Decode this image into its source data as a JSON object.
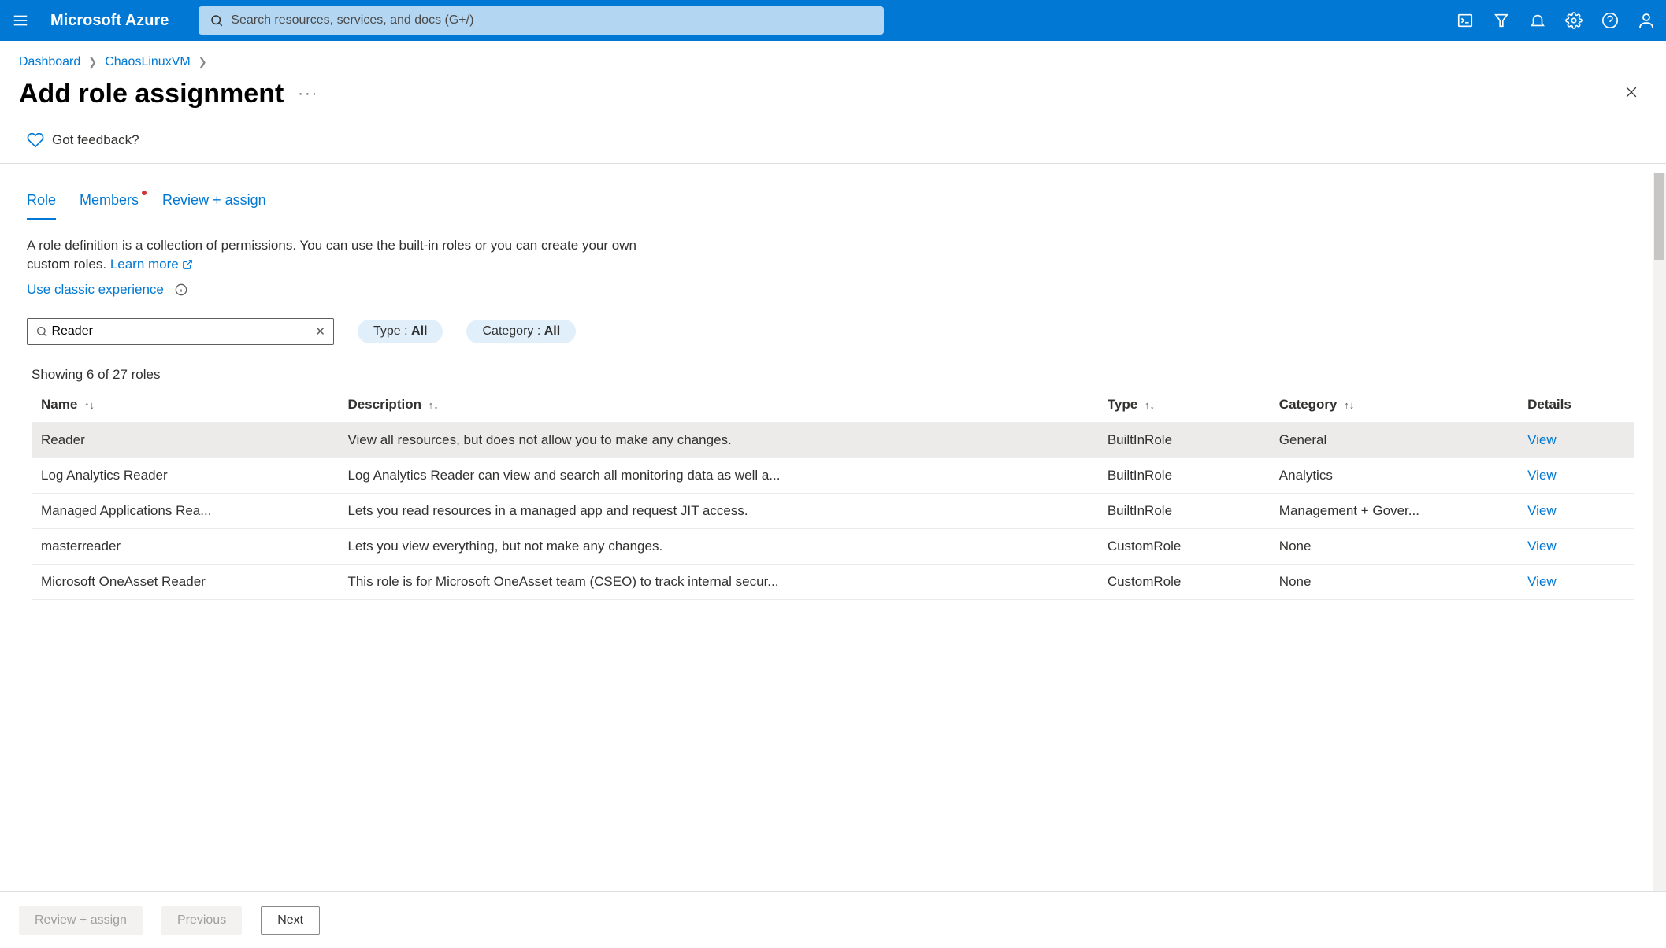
{
  "header": {
    "brand": "Microsoft Azure",
    "search_placeholder": "Search resources, services, and docs (G+/)"
  },
  "breadcrumb": {
    "items": [
      "Dashboard",
      "ChaosLinuxVM"
    ]
  },
  "title": "Add role assignment",
  "feedback": "Got feedback?",
  "tabs": {
    "role": "Role",
    "members": "Members",
    "review": "Review + assign",
    "active": "role"
  },
  "info": {
    "lead": "A role definition is a collection of permissions. You can use the built-in roles or you can create your own custom roles. ",
    "learn_more": "Learn more",
    "classic": "Use classic experience"
  },
  "filter": {
    "search_value": "Reader",
    "type_label": "Type : ",
    "type_value": "All",
    "cat_label": "Category : ",
    "cat_value": "All"
  },
  "table": {
    "showing": "Showing 6 of 27 roles",
    "columns": {
      "name": "Name",
      "desc": "Description",
      "type": "Type",
      "cat": "Category",
      "details": "Details"
    },
    "view_label": "View",
    "rows": [
      {
        "name": "Reader",
        "desc": "View all resources, but does not allow you to make any changes.",
        "type": "BuiltInRole",
        "cat": "General",
        "selected": true
      },
      {
        "name": "Log Analytics Reader",
        "desc": "Log Analytics Reader can view and search all monitoring data as well a...",
        "type": "BuiltInRole",
        "cat": "Analytics",
        "selected": false
      },
      {
        "name": "Managed Applications Rea...",
        "desc": "Lets you read resources in a managed app and request JIT access.",
        "type": "BuiltInRole",
        "cat": "Management + Gover...",
        "selected": false
      },
      {
        "name": "masterreader",
        "desc": "Lets you view everything, but not make any changes.",
        "type": "CustomRole",
        "cat": "None",
        "selected": false
      },
      {
        "name": "Microsoft OneAsset Reader",
        "desc": "This role is for Microsoft OneAsset team (CSEO) to track internal secur...",
        "type": "CustomRole",
        "cat": "None",
        "selected": false
      }
    ]
  },
  "footer": {
    "review": "Review + assign",
    "previous": "Previous",
    "next": "Next"
  }
}
